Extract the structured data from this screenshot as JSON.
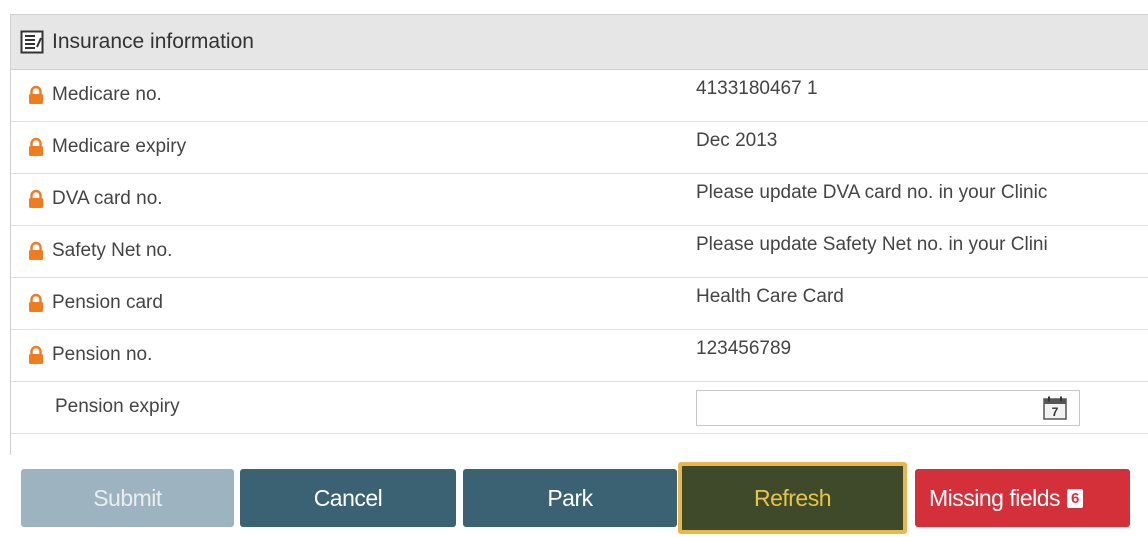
{
  "section": {
    "title": "Insurance information",
    "icon": "form-list-icon"
  },
  "fields": [
    {
      "label": "Medicare no.",
      "value": "4133180467 1",
      "locked": true
    },
    {
      "label": "Medicare expiry",
      "value": "Dec 2013",
      "locked": true
    },
    {
      "label": "DVA card no.",
      "value": "Please update DVA card no. in your Clinic",
      "locked": true
    },
    {
      "label": "Safety Net no.",
      "value": "Please update Safety Net no. in your Clini",
      "locked": true
    },
    {
      "label": "Pension card",
      "value": "Health Care Card",
      "locked": true
    },
    {
      "label": "Pension no.",
      "value": "123456789",
      "locked": true
    }
  ],
  "pension_expiry": {
    "label": "Pension expiry",
    "value": "",
    "calendar_icon_text": "7"
  },
  "buttons": {
    "submit": "Submit",
    "cancel": "Cancel",
    "park": "Park",
    "refresh": "Refresh",
    "missing_fields": "Missing fields",
    "missing_count": "6"
  },
  "colors": {
    "lock": "#f07c22",
    "submit_disabled": "#9db4c0",
    "primary": "#3b6272",
    "refresh_bg": "#3e4a2a",
    "refresh_text": "#e6c549",
    "refresh_border": "#e9b84c",
    "missing": "#d3303a",
    "header_bg": "#e6e6e6"
  }
}
